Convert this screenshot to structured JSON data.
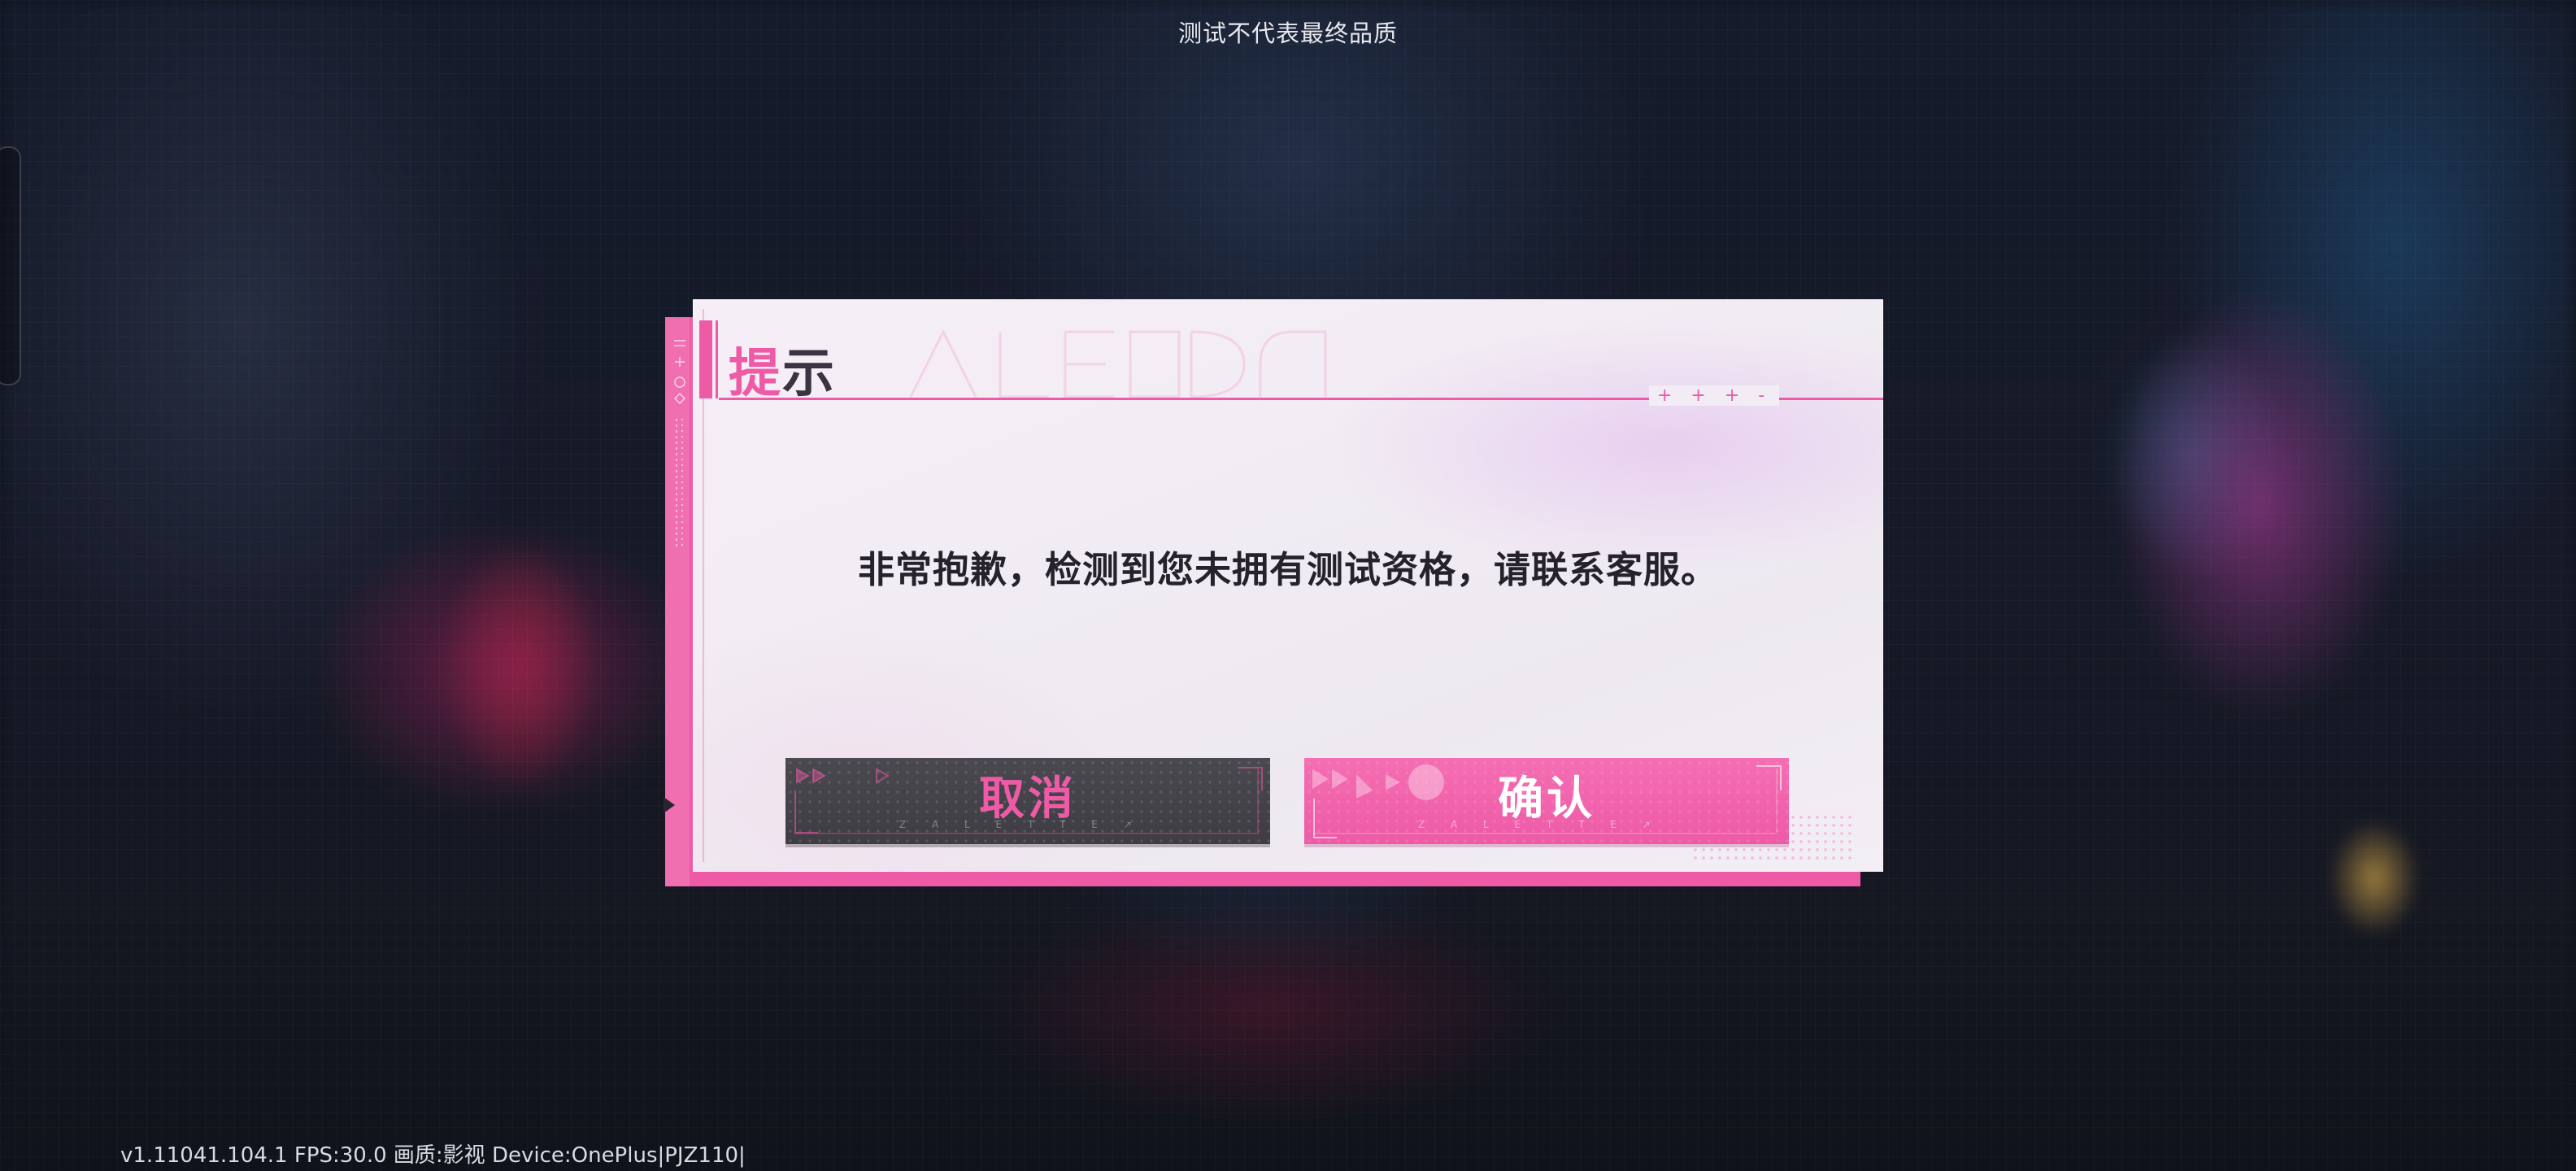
{
  "top_notice": "测试不代表最终品质",
  "dialog": {
    "title_first": "提",
    "title_rest": "示",
    "message": "非常抱歉，检测到您未拥有测试资格，请联系客服。",
    "stars": "+ + + -",
    "cancel_label": "取消",
    "confirm_label": "确认"
  },
  "footer": {
    "info": "v1.11041.104.1 FPS:30.0 画质:影视 Device:OnePlus|PJZ110|"
  },
  "colors": {
    "accent_pink": "#ee5aa6",
    "cancel_button_bg": "#45444a",
    "confirm_button_bg": "#f16aae",
    "message_text": "#25222b"
  }
}
